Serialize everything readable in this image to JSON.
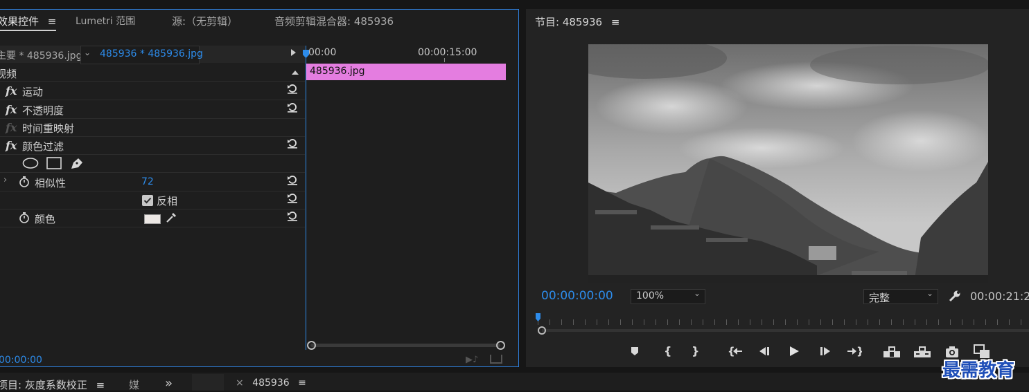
{
  "effect_controls": {
    "tabs": [
      "效果控件",
      "Lumetri 范围",
      "源:（无剪辑）",
      "音频剪辑混合器: 485936"
    ],
    "menu_symbol": "≡",
    "source_path": "主要 * 485936.jpg",
    "clip_path": "485936 * 485936.jpg",
    "section_label": "视频",
    "effects": [
      {
        "label": "运动"
      },
      {
        "label": "不透明度"
      },
      {
        "label": "时间重映射"
      },
      {
        "label": "颜色过滤"
      }
    ],
    "fx_glyph": "fx",
    "similarity": {
      "label": "相似性",
      "value": "72"
    },
    "invert": {
      "label": "反相",
      "checked": true
    },
    "color": {
      "label": "颜色",
      "swatch": "#ece7e4"
    },
    "timeline": {
      "ruler_start": "00:00",
      "ruler_mid": "00:00:15:00",
      "clip_label": "485936.jpg",
      "clip_color": "#e47de0"
    },
    "current_time": "00:00:00"
  },
  "program_monitor": {
    "title": "节目: 485936",
    "timecode": "00:00:00:00",
    "zoom": "100%",
    "quality": "完整",
    "duration": "00:00:21:2",
    "playhead_fraction": 0
  },
  "bottom_tabs": {
    "project": "项目: 灰度系数校正",
    "media": "媒",
    "sequence": "485936",
    "more": "»",
    "close_symbol": "×"
  },
  "watermark": "最需教育",
  "colors": {
    "accent": "#2d8ceb",
    "panel_border": "#2f7fdc",
    "clip": "#e47de0"
  }
}
